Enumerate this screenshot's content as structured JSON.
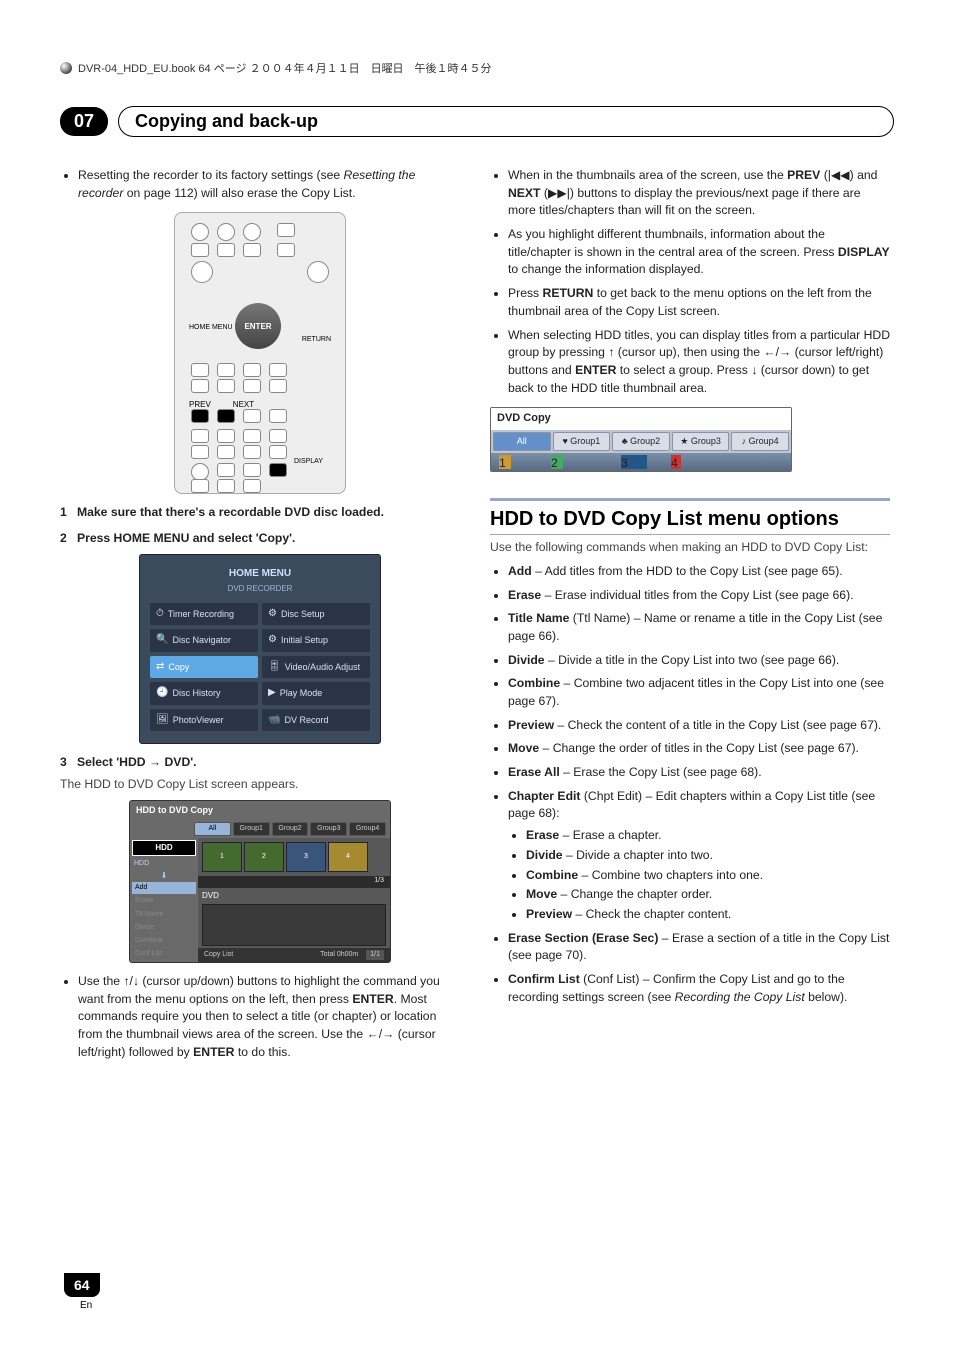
{
  "header_line": "DVR-04_HDD_EU.book 64 ページ ２００４年４月１１日　日曜日　午後１時４５分",
  "chapter": {
    "number": "07",
    "title": "Copying and back-up"
  },
  "page_number": "64",
  "page_lang": "En",
  "left": {
    "reset_bullet_1a": "Resetting the recorder to its factory settings (see ",
    "reset_bullet_1b": "Resetting the recorder",
    "reset_bullet_1c": " on page 112) will also erase the Copy List.",
    "remote": {
      "home_menu": "HOME MENU",
      "enter": "ENTER",
      "return": "RETURN",
      "prev": "PREV",
      "next": "NEXT",
      "display": "DISPLAY"
    },
    "step1_num": "1",
    "step1_title": "Make sure that there's a recordable DVD disc loaded.",
    "step2_num": "2",
    "step2_title": "Press HOME MENU and select 'Copy'.",
    "home_menu_ui": {
      "title": "HOME MENU",
      "subtitle": "DVD RECORDER",
      "items": [
        "Timer Recording",
        "Disc Setup",
        "Disc Navigator",
        "Initial Setup",
        "Copy",
        "Video/Audio Adjust",
        "Disc History",
        "Play Mode",
        "PhotoViewer",
        "DV Record"
      ]
    },
    "step3_num": "3",
    "step3_title": "Select 'HDD → DVD'.",
    "step3_body": "The HDD to DVD Copy List screen appears.",
    "copy_list_ui": {
      "title": "HDD to DVD Copy",
      "tabs": [
        "All",
        "Group1",
        "Group2",
        "Group3",
        "Group4"
      ],
      "hdd_badge": "HDD",
      "hdd_sub": "HDD",
      "dvd_badge": "DVD",
      "options": [
        "Add",
        "Erase",
        "Ttl Name",
        "Divide",
        "Combine",
        "Conf List"
      ],
      "thumb_counter": "1/3",
      "footer_left": "Copy List",
      "footer_total": "Total  0h00m",
      "footer_right": "1/1"
    },
    "use_bullet": "Use the ↑/↓ (cursor up/down) buttons to highlight the command you want from the menu options on the left, then press ENTER. Most commands require you then to select a title (or chapter) or location from the thumbnail views area of the screen. Use the ←/→ (cursor left/right) followed by ENTER to do this."
  },
  "right": {
    "bullets_top": [
      "When in the thumbnails area of the screen, use the PREV (|◀◀) and NEXT (▶▶|) buttons to display the previous/next page if there are more titles/chapters than will fit on the screen.",
      "As you highlight different thumbnails, information about the title/chapter is shown in the central area of the screen. Press DISPLAY to change the information displayed.",
      "Press RETURN to get back to the menu options on the left from the thumbnail area of the Copy List screen.",
      "When selecting HDD titles, you can display titles from a particular HDD group by pressing ↑ (cursor up), then using the ←/→ (cursor left/right) buttons and ENTER to select a group. Press ↓ (cursor down) to get back to the HDD title thumbnail area."
    ],
    "dvd_copy_ui": {
      "title": "DVD Copy",
      "tabs": [
        "All",
        "Group1",
        "Group2",
        "Group3",
        "Group4"
      ]
    },
    "section_title": "HDD to DVD Copy List menu options",
    "section_lead": "Use the following commands when making an HDD to DVD Copy List:",
    "options": [
      {
        "b": "Add",
        "t": " – Add titles from the HDD to the Copy List (see page 65)."
      },
      {
        "b": "Erase",
        "t": " – Erase individual titles from the Copy List (see page 66)."
      },
      {
        "b": "Title Name",
        "p": " (Ttl Name)",
        "t": " – Name or rename a title in the Copy List (see page 66)."
      },
      {
        "b": "Divide",
        "t": " – Divide a title in the Copy List into two (see page 66)."
      },
      {
        "b": "Combine",
        "t": " – Combine two adjacent titles in the Copy List into one (see page 67)."
      },
      {
        "b": "Preview",
        "t": " – Check the content of a title in the Copy List (see page 67)."
      },
      {
        "b": "Move",
        "t": " – Change the order of titles in the Copy List (see page 67)."
      },
      {
        "b": "Erase All",
        "t": " – Erase the Copy List (see page 68)."
      }
    ],
    "chapter_edit_head_b": "Chapter Edit",
    "chapter_edit_head_p": " (Chpt Edit)",
    "chapter_edit_head_t": " – Edit chapters within a Copy List title (see page 68):",
    "chapter_edit_items": [
      {
        "b": "Erase",
        "t": " – Erase a chapter."
      },
      {
        "b": "Divide",
        "t": " – Divide a chapter into two."
      },
      {
        "b": "Combine",
        "t": " – Combine two chapters into one."
      },
      {
        "b": "Move",
        "t": " – Change the chapter order."
      },
      {
        "b": "Preview",
        "t": " – Check the chapter content."
      }
    ],
    "erase_section_b": "Erase Section (Erase Sec)",
    "erase_section_t": " – Erase a section of a title in the Copy List (see page 70).",
    "confirm_b": "Confirm List",
    "confirm_p": " (Conf List)",
    "confirm_t1": " – Confirm the Copy List and go to the recording settings screen (see ",
    "confirm_i": "Recording the Copy List",
    "confirm_t2": " below)."
  }
}
